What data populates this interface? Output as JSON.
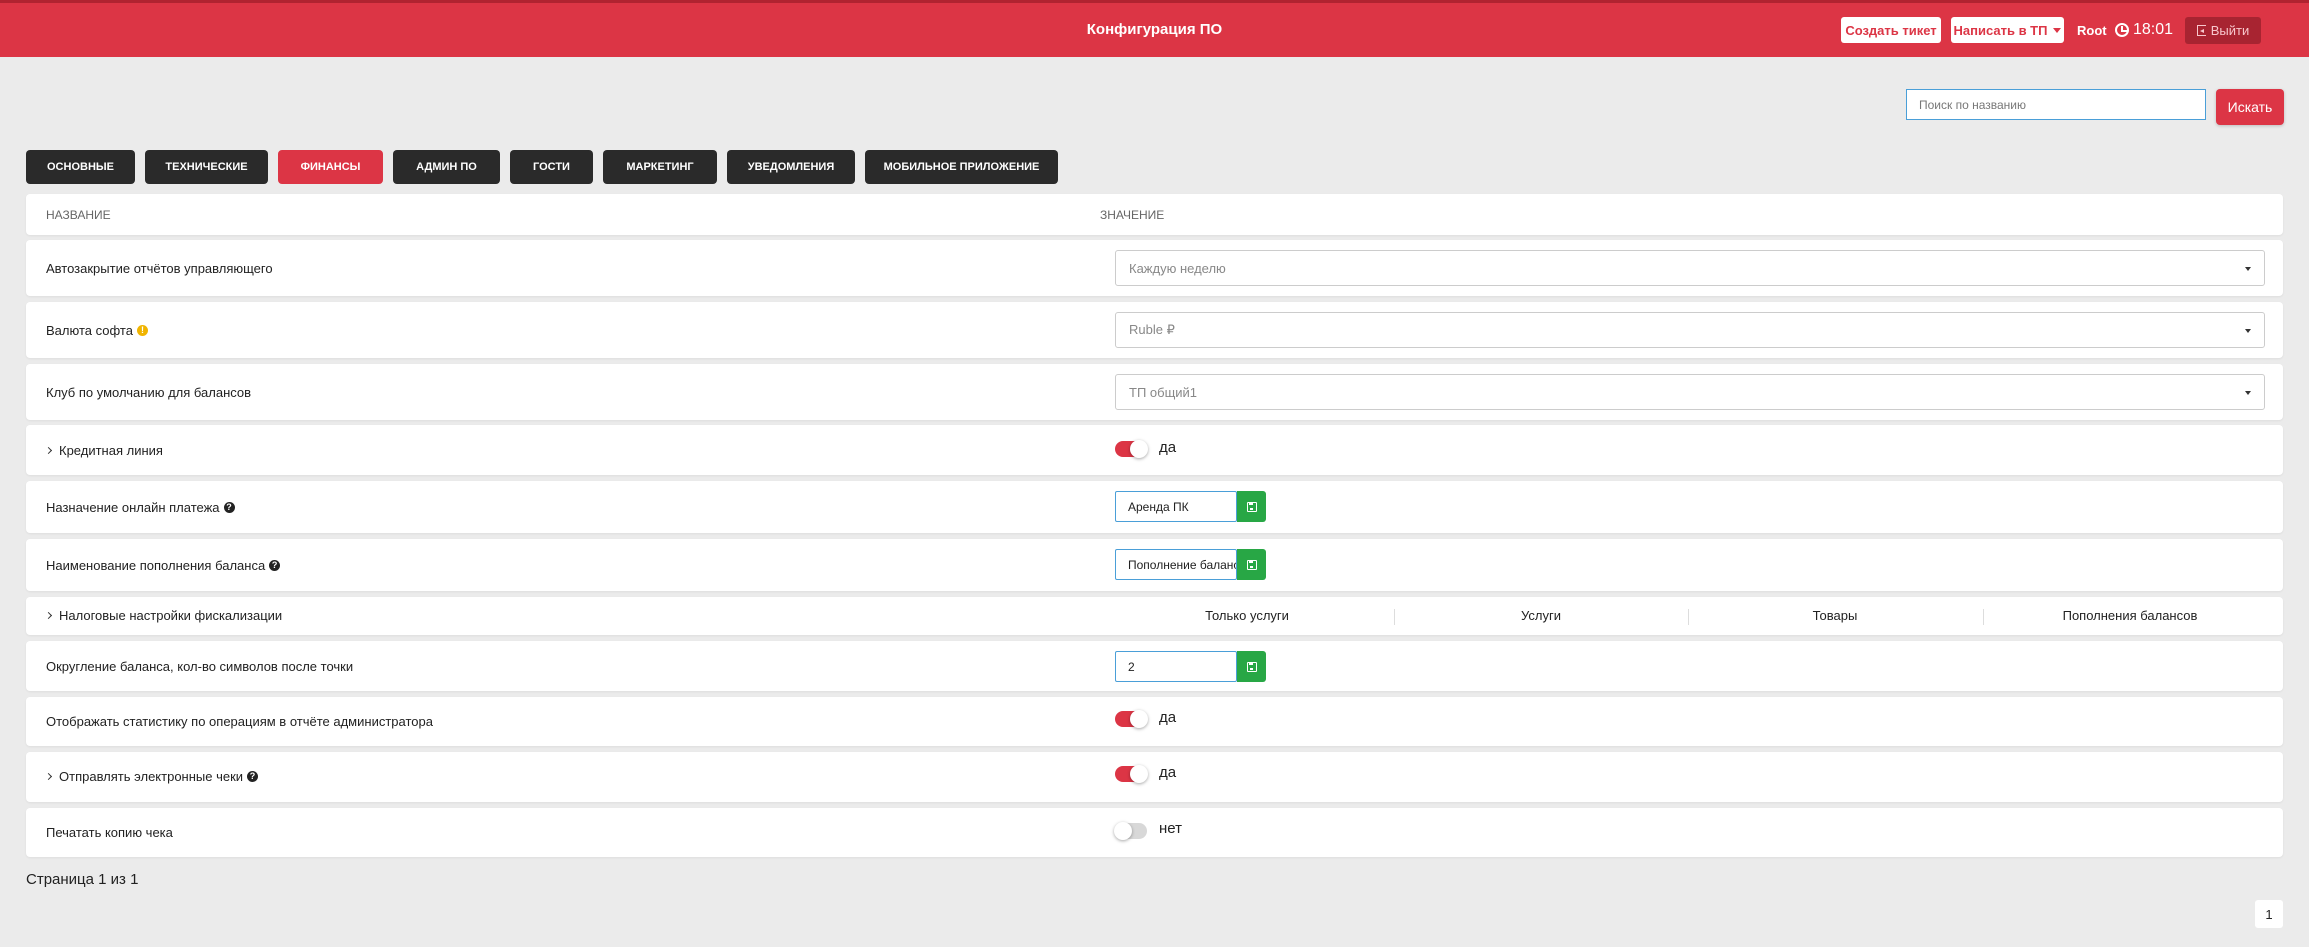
{
  "header": {
    "title": "Конфигурация ПО",
    "create_ticket": "Создать тикет",
    "write_tp": "Написать в ТП",
    "user": "Root",
    "time": "18:01",
    "logout": "Выйти"
  },
  "search": {
    "placeholder": "Поиск по названию",
    "button": "Искать"
  },
  "tabs": [
    {
      "label": "Основные"
    },
    {
      "label": "Технические"
    },
    {
      "label": "Финансы",
      "active": true
    },
    {
      "label": "Админ ПО"
    },
    {
      "label": "Гости"
    },
    {
      "label": "Маркетинг"
    },
    {
      "label": "Уведомления"
    },
    {
      "label": "Мобильное приложение"
    }
  ],
  "table": {
    "col_name": "НАЗВАНИЕ",
    "col_value": "ЗНАЧЕНИЕ",
    "rows": {
      "auto_close": {
        "label": "Автозакрытие отчётов управляющего",
        "value": "Каждую неделю"
      },
      "currency": {
        "label": "Валюта софта",
        "value": "Ruble ₽"
      },
      "default_club": {
        "label": "Клуб по умолчанию для балансов",
        "value": "ТП общий1"
      },
      "credit_line": {
        "label": "Кредитная линия",
        "value": "да"
      },
      "payment_purpose": {
        "label": "Назначение онлайн платежа",
        "value": "Аренда ПК"
      },
      "topup_name": {
        "label": "Наименование пополнения баланса",
        "value": "Пополнение баланса"
      },
      "tax_settings": {
        "label": "Налоговые настройки фискализации",
        "columns": [
          "Только услуги",
          "Услуги",
          "Товары",
          "Пополнения балансов"
        ]
      },
      "rounding": {
        "label": "Округление баланса, кол-во символов после точки",
        "value": "2"
      },
      "stats": {
        "label": "Отображать статистику по операциям в отчёте администратора",
        "value": "да"
      },
      "e_receipts": {
        "label": "Отправлять электронные чеки",
        "value": "да"
      },
      "print_copy": {
        "label": "Печатать копию чека",
        "value": "нет"
      }
    }
  },
  "pager": {
    "text": "Страница 1 из 1",
    "current": "1"
  },
  "colors": {
    "accent": "#dc3545",
    "dark": "#2a2a2a",
    "save": "#28a745"
  }
}
